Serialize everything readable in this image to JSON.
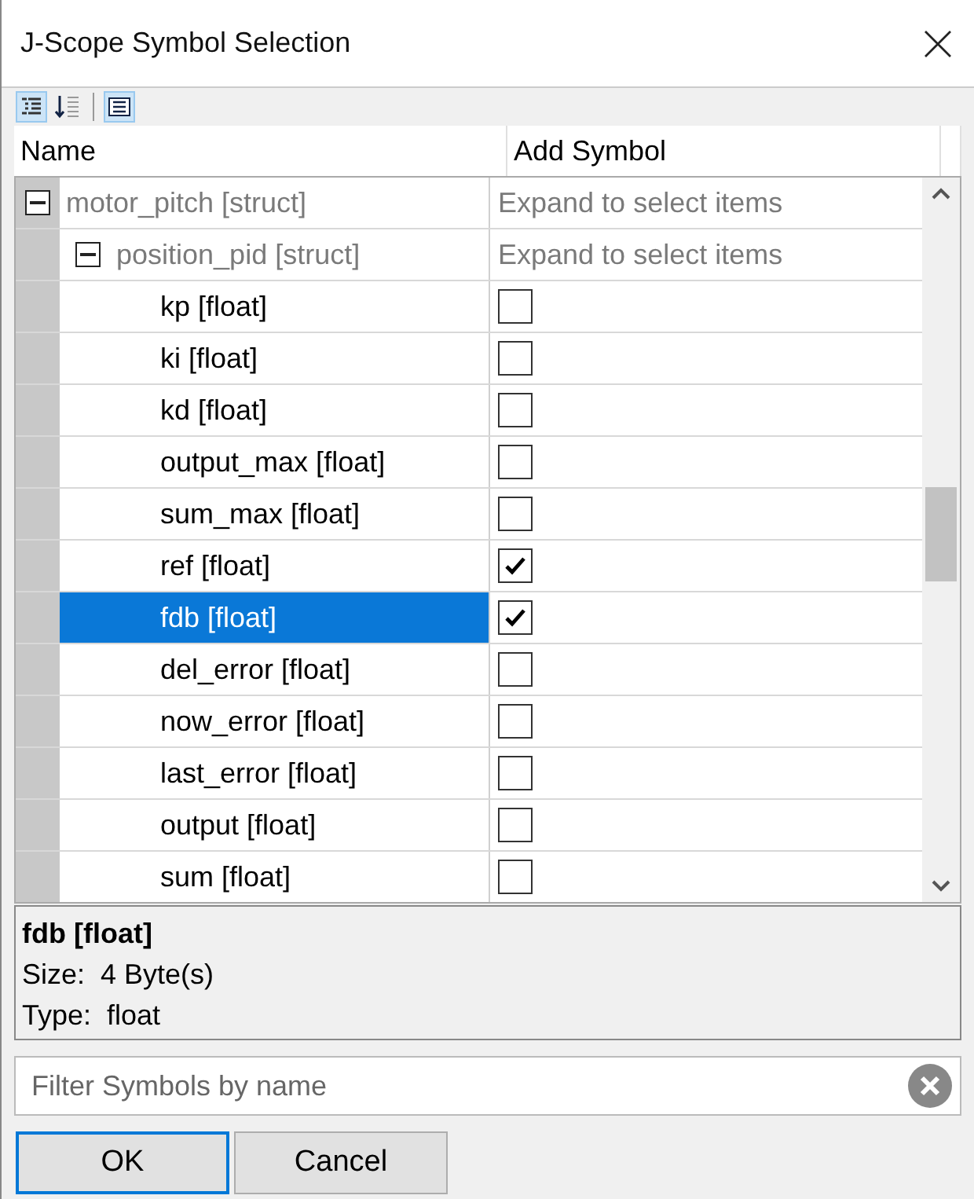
{
  "window": {
    "title": "J-Scope Symbol Selection"
  },
  "toolbar": [
    {
      "kind": "tree",
      "selected": true
    },
    {
      "kind": "sort",
      "selected": false
    },
    {
      "kind": "list",
      "selected": true
    }
  ],
  "table": {
    "columns": [
      "Name",
      "Add Symbol"
    ],
    "rows": [
      {
        "kind": "struct",
        "name": "motor_pitch [struct]",
        "hint": "Expand to select items",
        "expanded": true,
        "selected": false,
        "children": [
          {
            "kind": "struct",
            "name": "position_pid [struct]",
            "hint": "Expand to select items",
            "expanded": true,
            "selected": false,
            "children": [
              {
                "kind": "item",
                "name": "kp [float]",
                "checked": false,
                "selected": false
              },
              {
                "kind": "item",
                "name": "ki [float]",
                "checked": false,
                "selected": false
              },
              {
                "kind": "item",
                "name": "kd [float]",
                "checked": false,
                "selected": false
              },
              {
                "kind": "item",
                "name": "output_max [float]",
                "checked": false,
                "selected": false
              },
              {
                "kind": "item",
                "name": "sum_max [float]",
                "checked": false,
                "selected": false
              },
              {
                "kind": "item",
                "name": "ref [float]",
                "checked": true,
                "selected": false
              },
              {
                "kind": "item",
                "name": "fdb [float]",
                "checked": true,
                "selected": true
              },
              {
                "kind": "item",
                "name": "del_error [float]",
                "checked": false,
                "selected": false
              },
              {
                "kind": "item",
                "name": "now_error [float]",
                "checked": false,
                "selected": false
              },
              {
                "kind": "item",
                "name": "last_error [float]",
                "checked": false,
                "selected": false
              },
              {
                "kind": "item",
                "name": "output [float]",
                "checked": false,
                "selected": false
              },
              {
                "kind": "item",
                "name": "sum [float]",
                "checked": false,
                "selected": false
              }
            ]
          }
        ]
      }
    ]
  },
  "info": {
    "title": "fdb [float]",
    "lines": [
      {
        "label": "Size:",
        "value": "4 Byte(s)"
      },
      {
        "label": "Type:",
        "value": "float"
      }
    ]
  },
  "filter": {
    "placeholder": "Filter Symbols by name"
  },
  "buttons": [
    {
      "label": "OK",
      "kind": "default"
    },
    {
      "label": "Cancel",
      "kind": "normal"
    }
  ]
}
